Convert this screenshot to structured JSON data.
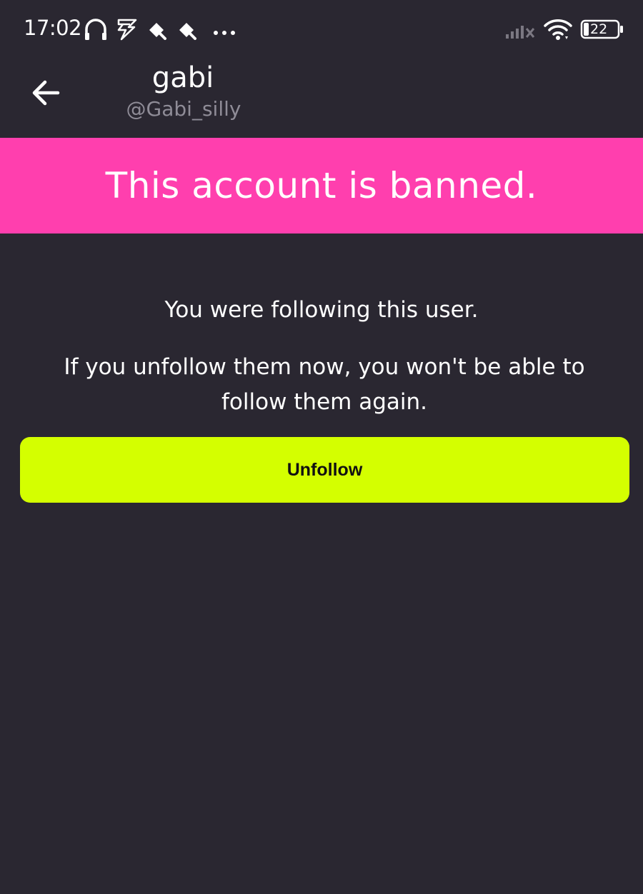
{
  "status_bar": {
    "time": "17:02",
    "battery_level": "22",
    "icons": [
      "headphones-icon",
      "sync-bolt-icon",
      "notification-app-icon",
      "notification-app-icon",
      "more-dots-icon",
      "signal-no-service-icon",
      "wifi-icon",
      "battery-icon"
    ]
  },
  "header": {
    "back_icon": "arrow-left-icon",
    "name": "gabi",
    "handle": "@Gabi_silly"
  },
  "banner": {
    "text": "This account is banned.",
    "color": "#ff3fae"
  },
  "notice": {
    "primary": "You were following this user.",
    "secondary": "If you unfollow them now, you won't be able to follow them again."
  },
  "actions": {
    "unfollow_label": "Unfollow",
    "unfollow_color": "#d4ff00"
  },
  "colors": {
    "background": "#2a2731",
    "handle_text": "#8f8c97"
  }
}
